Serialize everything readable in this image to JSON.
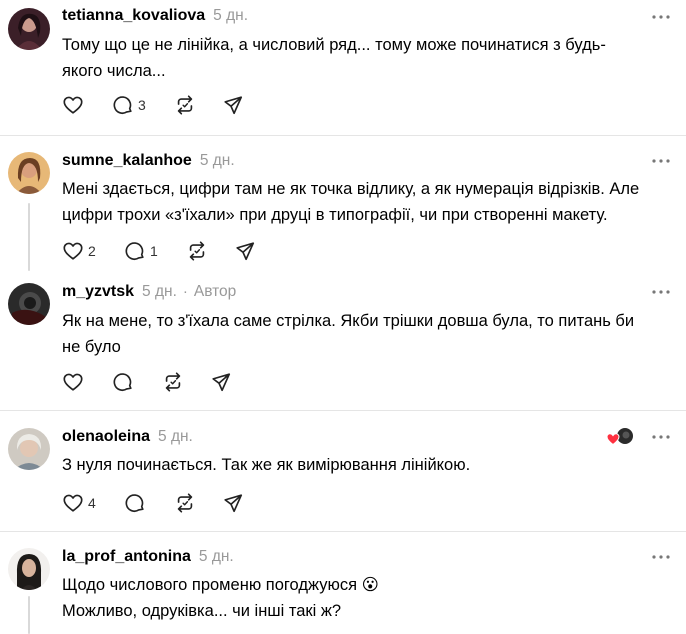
{
  "comments": [
    {
      "username": "tetianna_kovaliova",
      "time": "5 дн.",
      "text_lines": [
        "Тому що це не лінійка, а числовий ряд... тому може починатися з будь-",
        "якого числа..."
      ],
      "reply_count": "3"
    },
    {
      "username": "sumne_kalanhoe",
      "time": "5 дн.",
      "text_lines": [
        "Мені здається, цифри там не як точка відлику, а як нумерація відрізків. Але",
        "цифри трохи «з'їхали» при друці в типографії, чи при створенні макету."
      ],
      "like_count": "2",
      "reply_count": "1"
    },
    {
      "username": "m_yzvtsk",
      "time": "5 дн.",
      "dot": "·",
      "author_label": "Автор",
      "text_lines": [
        "Як на мене, то з'їхала саме стрілка. Якби трішки довша була, то питань би",
        "не було"
      ]
    },
    {
      "username": "olenaoleina",
      "time": "5 дн.",
      "text_lines": [
        "З нуля починається. Так же як вимірювання лінійкою."
      ],
      "like_count": "4"
    },
    {
      "username": "la_prof_antonina",
      "time": "5 дн.",
      "text_lines": [
        "Щодо числового променю погоджуюся 😮",
        "Можливо, одруківка... чи інші такі ж?"
      ]
    }
  ],
  "icons": {
    "like": "heart-icon",
    "reply": "comment-bubble-icon",
    "repost": "repost-icon",
    "share": "send-icon",
    "more": "more-horizontal-icon"
  },
  "colors": {
    "muted": "#999999",
    "separator": "#e5e5e5",
    "liked_heart": "#ff3040"
  }
}
